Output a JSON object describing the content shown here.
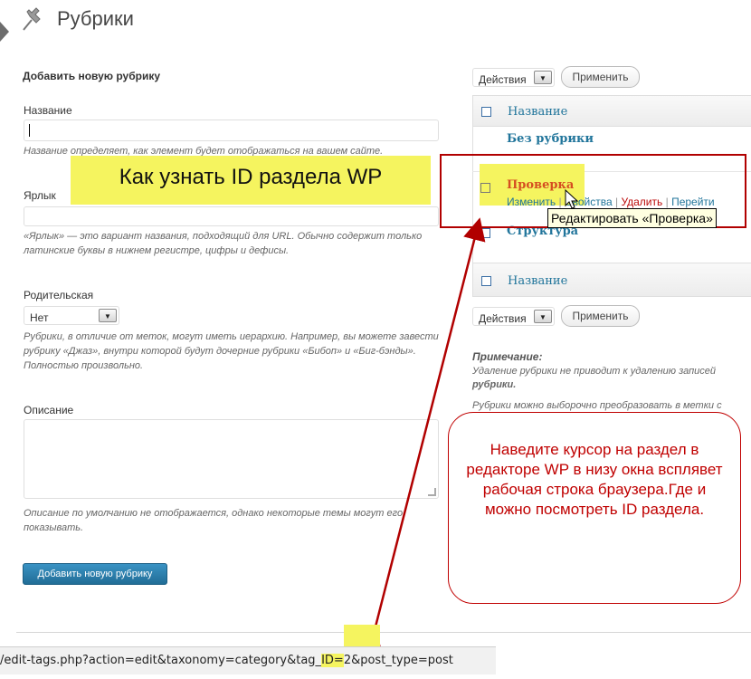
{
  "page": {
    "title": "Рубрики"
  },
  "add_form": {
    "heading": "Добавить новую рубрику",
    "name_label": "Название",
    "name_value": "",
    "name_hint": "Название определяет, как элемент будет отображаться на вашем сайте.",
    "slug_label": "Ярлык",
    "slug_hint": "«Ярлык» — это вариант названия, подходящий для URL. Обычно содержит только латинские буквы в нижнем регистре, цифры и дефисы.",
    "parent_label": "Родительская",
    "parent_value": "Нет",
    "parent_hint": "Рубрики, в отличие от меток, могут иметь иерархию. Например, вы можете завести рубрику «Джаз», внутри которой будут дочерние рубрики «Бибоп» и «Биг-бэнды». Полностью произвольно.",
    "desc_label": "Описание",
    "desc_hint": "Описание по умолчанию не отображается, однако некоторые темы могут его показывать.",
    "submit_label": "Добавить новую рубрику"
  },
  "bulk": {
    "action_value": "Действия",
    "apply_label": "Применить"
  },
  "table": {
    "column_name": "Название",
    "rows": [
      {
        "name": "Без рубрики"
      },
      {
        "name": "Проверка",
        "actions": [
          "Изменить",
          "Свойства",
          "Удалить",
          "Перейти"
        ]
      },
      {
        "name": "Структура"
      }
    ]
  },
  "note": {
    "title": "Примечание:",
    "text1a": "Удаление рубрики не приводит к удалению записей",
    "text1b": "рубрики.",
    "text2": "Рубрики можно выборочно преобразовать в метки с"
  },
  "annotations": {
    "banner": "Как узнать ID раздела WP",
    "tooltip": "Редактировать «Проверка»",
    "callout": "Наведите курсор на раздел в редакторе WP в низу окна всплявет рабочая строка браузера.Где и можно посмотреть ID раздела."
  },
  "statusbar": {
    "url_prefix": "/edit-tags.php?action=edit&taxonomy=category&tag_",
    "url_highlight": "ID=",
    "url_id": "2",
    "url_suffix": "&post_type=post"
  },
  "colors": {
    "accent": "#21759b",
    "annotation_red": "#b10000",
    "highlight_yellow": "#f5f45f"
  }
}
